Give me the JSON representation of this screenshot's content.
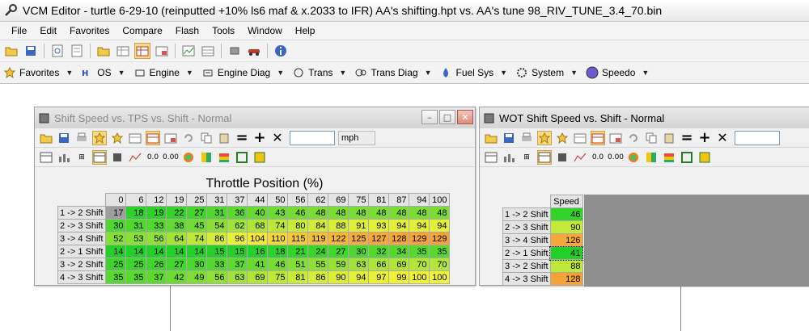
{
  "app": {
    "title": "VCM Editor - turtle 6-29-10 (reinputted +10% ls6 maf & x.2033 to IFR) AA's shifting.hpt  vs.  AA's tune 98_RIV_TUNE_3.4_70.bin"
  },
  "menu": [
    "File",
    "Edit",
    "Favorites",
    "Compare",
    "Flash",
    "Tools",
    "Window",
    "Help"
  ],
  "nav": [
    {
      "label": "Favorites",
      "icon": "star-icon"
    },
    {
      "label": "OS",
      "icon": "hp-logo-icon"
    },
    {
      "label": "Engine",
      "icon": "engine-icon"
    },
    {
      "label": "Engine Diag",
      "icon": "engine-diag-icon"
    },
    {
      "label": "Trans",
      "icon": "trans-icon"
    },
    {
      "label": "Trans Diag",
      "icon": "trans-diag-icon"
    },
    {
      "label": "Fuel Sys",
      "icon": "fuel-drop-icon"
    },
    {
      "label": "System",
      "icon": "system-gear-icon"
    },
    {
      "label": "Speedo",
      "icon": "speedo-icon"
    }
  ],
  "window1": {
    "title": "Shift Speed vs. TPS vs. Shift - Normal",
    "unit": "mph",
    "axis_title": "Throttle Position (%)",
    "columns": [
      "0",
      "6",
      "12",
      "19",
      "25",
      "31",
      "37",
      "44",
      "50",
      "56",
      "62",
      "69",
      "75",
      "81",
      "87",
      "94",
      "100"
    ],
    "rows": [
      {
        "label": "1 -> 2 Shift",
        "values": [
          17,
          18,
          19,
          22,
          27,
          31,
          36,
          40,
          43,
          46,
          48,
          48,
          48,
          48,
          48,
          48,
          48
        ]
      },
      {
        "label": "2 -> 3 Shift",
        "values": [
          30,
          31,
          33,
          38,
          45,
          54,
          62,
          68,
          74,
          80,
          84,
          88,
          91,
          93,
          94,
          94,
          94
        ]
      },
      {
        "label": "3 -> 4 Shift",
        "values": [
          52,
          53,
          56,
          64,
          74,
          86,
          96,
          104,
          110,
          115,
          119,
          122,
          125,
          127,
          128,
          129,
          129
        ]
      },
      {
        "label": "2 -> 1 Shift",
        "values": [
          14,
          14,
          14,
          14,
          14,
          15,
          15,
          16,
          18,
          21,
          24,
          27,
          30,
          32,
          34,
          35,
          35
        ]
      },
      {
        "label": "3 -> 2 Shift",
        "values": [
          25,
          25,
          26,
          27,
          30,
          33,
          37,
          41,
          46,
          51,
          55,
          59,
          63,
          66,
          69,
          70,
          70
        ]
      },
      {
        "label": "4 -> 3 Shift",
        "values": [
          35,
          35,
          37,
          42,
          49,
          56,
          63,
          69,
          75,
          81,
          86,
          90,
          94,
          97,
          99,
          100,
          100
        ]
      }
    ]
  },
  "window2": {
    "title": "WOT Shift Speed vs. Shift - Normal",
    "column": "Speed",
    "rows": [
      {
        "label": "1 -> 2 Shift",
        "value": 46
      },
      {
        "label": "2 -> 3 Shift",
        "value": 90
      },
      {
        "label": "3 -> 4 Shift",
        "value": 126
      },
      {
        "label": "2 -> 1 Shift",
        "value": 41
      },
      {
        "label": "3 -> 2 Shift",
        "value": 88
      },
      {
        "label": "4 -> 3 Shift",
        "value": 128
      }
    ]
  },
  "colors": {
    "lowest": "#9e9e9e",
    "green": "#22d028",
    "yellow_green": "#b6e63a",
    "yellow": "#f2f23a",
    "orange": "#f4a23a",
    "selected_title_inactive": "#8a8a8a"
  }
}
